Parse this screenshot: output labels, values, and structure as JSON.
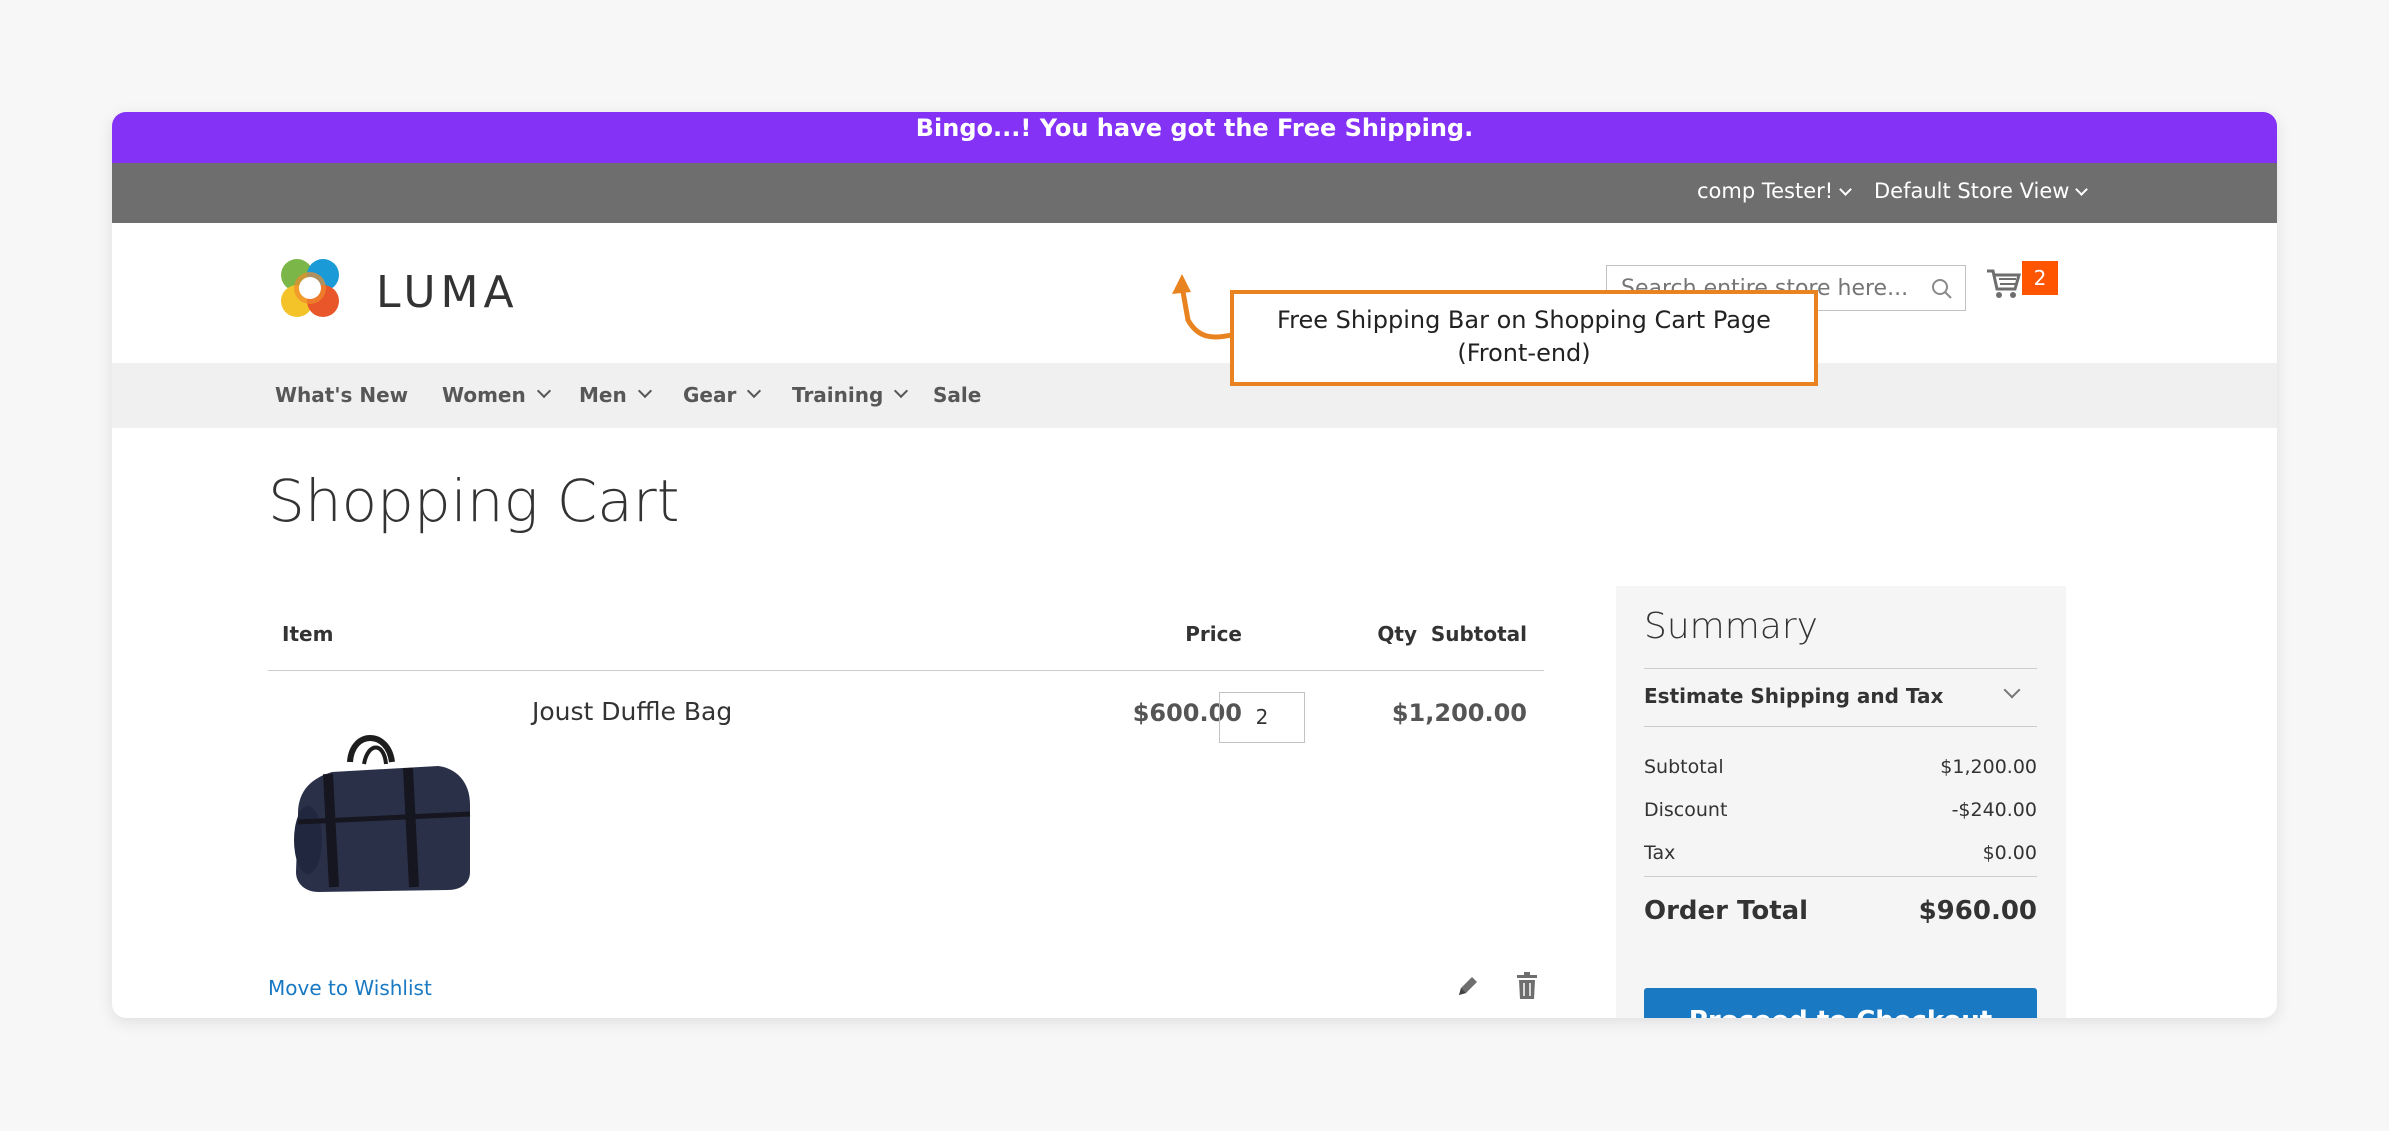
{
  "promo": {
    "message": "Bingo...! You have got the Free Shipping."
  },
  "panel": {
    "customer": "comp Tester!",
    "store_view": "Default Store View"
  },
  "header": {
    "logo_text": "LUMA",
    "search_placeholder": "Search entire store here...",
    "cart_count": "2"
  },
  "nav": {
    "items": [
      {
        "label": "What's New"
      },
      {
        "label": "Women"
      },
      {
        "label": "Men"
      },
      {
        "label": "Gear"
      },
      {
        "label": "Training"
      },
      {
        "label": "Sale"
      }
    ]
  },
  "page": {
    "title": "Shopping Cart"
  },
  "cart": {
    "columns": {
      "item": "Item",
      "price": "Price",
      "qty": "Qty",
      "subtotal": "Subtotal"
    },
    "rows": [
      {
        "name": "Joust Duffle Bag",
        "price": "$600.00",
        "qty": "2",
        "subtotal": "$1,200.00"
      }
    ],
    "move_to_wishlist": "Move to Wishlist"
  },
  "summary": {
    "title": "Summary",
    "estimate": "Estimate Shipping and Tax",
    "subtotal_label": "Subtotal",
    "subtotal_value": "$1,200.00",
    "discount_label": "Discount",
    "discount_value": "-$240.00",
    "tax_label": "Tax",
    "tax_value": "$0.00",
    "total_label": "Order Total",
    "total_value": "$960.00",
    "checkout_label": "Proceed to Checkout"
  },
  "callout": {
    "line1": "Free Shipping Bar on Shopping Cart Page",
    "line2": "(Front-end)"
  },
  "colors": {
    "promo_bar": "#8432f5",
    "callout_border": "#e8831f",
    "accent": "#1979c3",
    "cart_badge": "#ff5501"
  }
}
